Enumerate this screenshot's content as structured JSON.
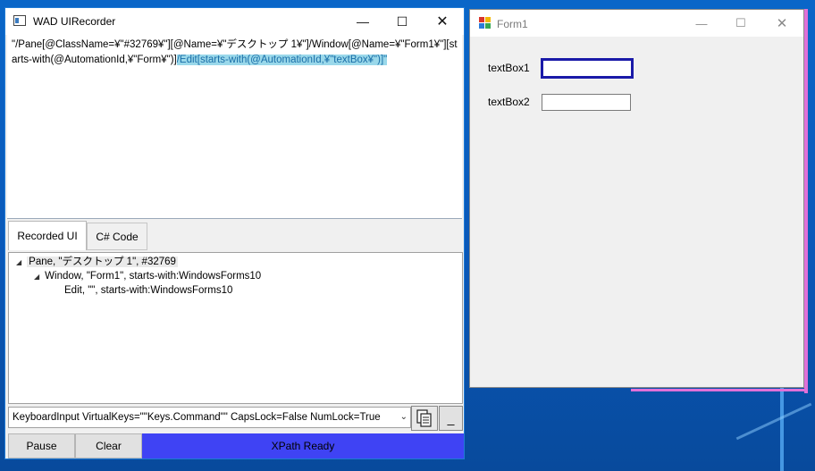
{
  "recorder": {
    "title": "WAD UIRecorder",
    "xpath_plain": "\"/Pane[@ClassName=¥\"#32769¥\"][@Name=¥\"デスクトップ 1¥\"]/Window[@Name=¥\"Form1¥\"][starts-with(@AutomationId,¥\"Form¥\")]",
    "xpath_highlight": "/Edit[starts-with(@AutomationId,¥\"textBox¥\")]\"",
    "tabs": [
      {
        "label": "Recorded UI",
        "active": true
      },
      {
        "label": "C# Code",
        "active": false
      }
    ],
    "tree": [
      {
        "text": "Pane, \"デスクトップ 1\", #32769",
        "level": 0,
        "expanded": true
      },
      {
        "text": "Window, \"Form1\", starts-with:WindowsForms10",
        "level": 1,
        "expanded": true
      },
      {
        "text": "Edit, \"\", starts-with:WindowsForms10",
        "level": 2,
        "expanded": false
      }
    ],
    "input_text": "KeyboardInput VirtualKeys=\"\"Keys.Command\"\" CapsLock=False NumLock=True",
    "minimize_label": "_",
    "pause_label": "Pause",
    "clear_label": "Clear",
    "status": "XPath Ready",
    "status_color": "#3f43f4"
  },
  "form1": {
    "title": "Form1",
    "label1": "textBox1",
    "label2": "textBox2",
    "textbox1_value": "",
    "textbox2_value": "",
    "focus_color": "#1a1aa8",
    "highlight_color": "#e070d8"
  }
}
